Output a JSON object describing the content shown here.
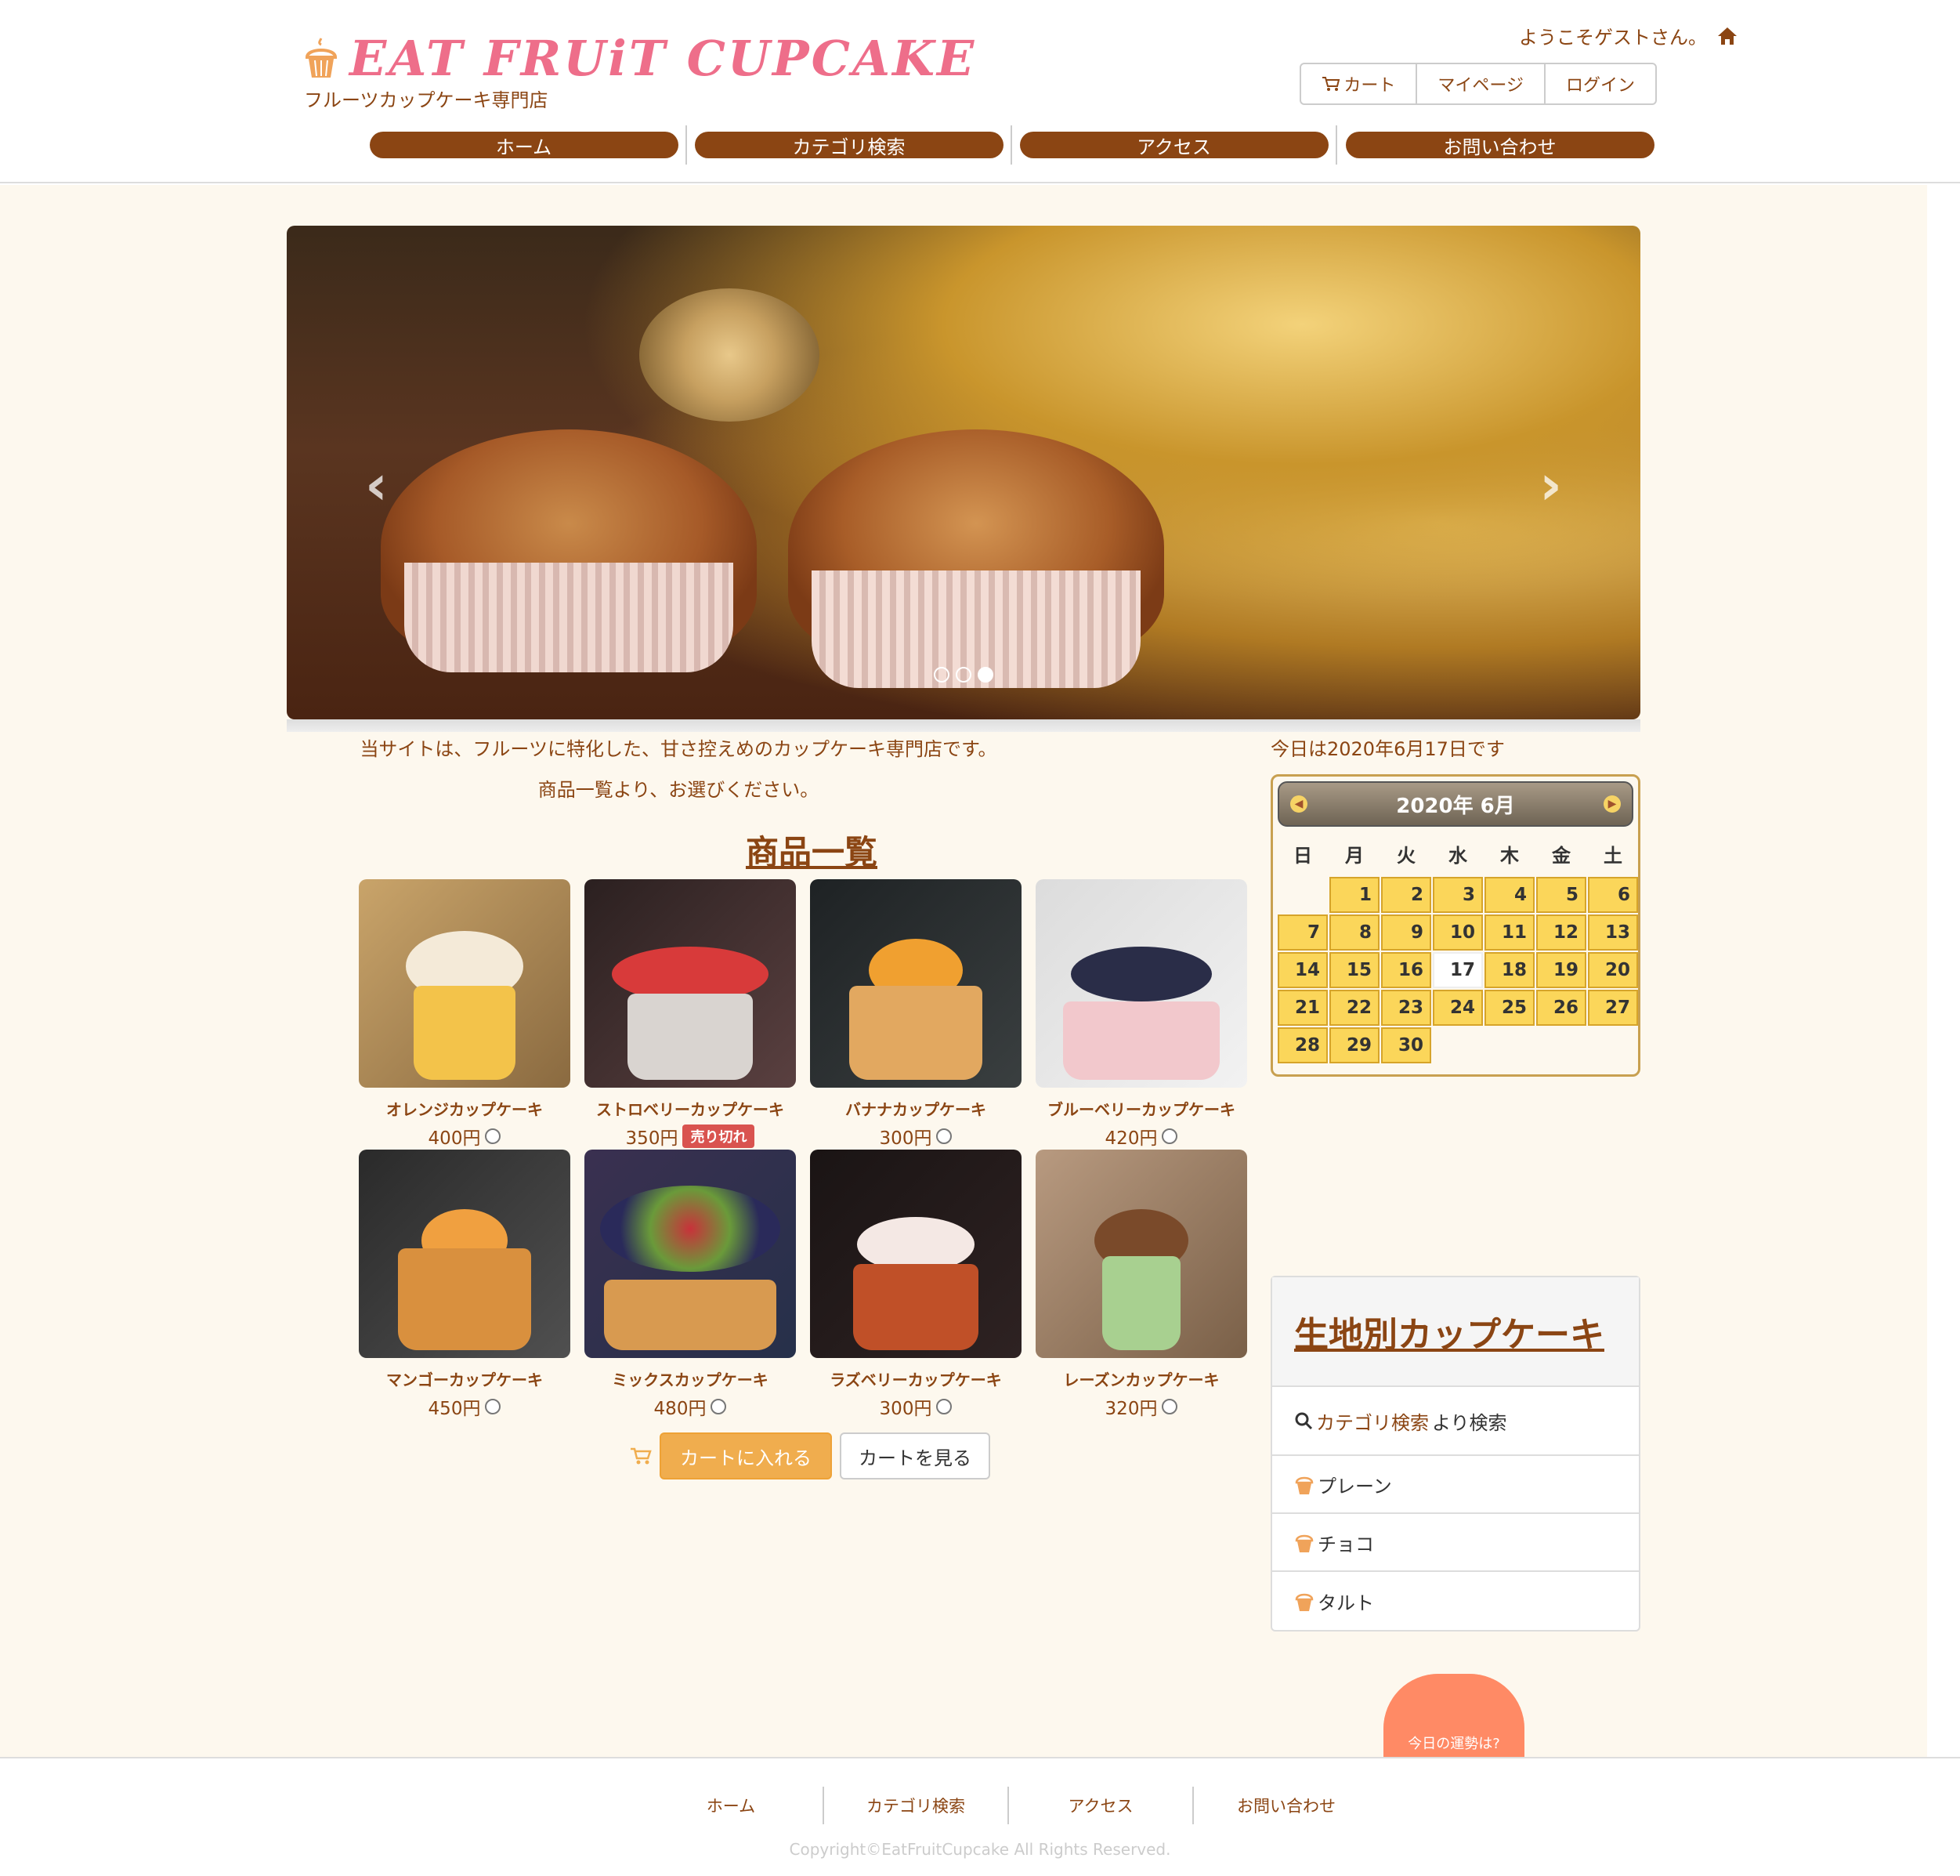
{
  "header": {
    "logo_text": "EAT FRUiT CUPCAKE",
    "tagline": "フルーツカップケーキ専門店",
    "welcome": "ようこそゲストさん。",
    "top_buttons": {
      "cart": "カート",
      "mypage": "マイページ",
      "login": "ログイン"
    },
    "nav": [
      "ホーム",
      "カテゴリ検索",
      "アクセス",
      "お問い合わせ"
    ]
  },
  "intro": {
    "line1": "当サイトは、フルーツに特化した、甘さ控えめのカップケーキ専門店です。",
    "line2": "商品一覧より、お選びください。"
  },
  "products_title": "商品一覧",
  "products": [
    {
      "name": "オレンジカップケーキ",
      "price": "400円",
      "sold_out": false
    },
    {
      "name": "ストロベリーカップケーキ",
      "price": "350円",
      "sold_out": true
    },
    {
      "name": "バナナカップケーキ",
      "price": "300円",
      "sold_out": false
    },
    {
      "name": "ブルーベリーカップケーキ",
      "price": "420円",
      "sold_out": false
    },
    {
      "name": "マンゴーカップケーキ",
      "price": "450円",
      "sold_out": false
    },
    {
      "name": "ミックスカップケーキ",
      "price": "480円",
      "sold_out": false
    },
    {
      "name": "ラズベリーカップケーキ",
      "price": "300円",
      "sold_out": false
    },
    {
      "name": "レーズンカップケーキ",
      "price": "320円",
      "sold_out": false
    }
  ],
  "sold_out_label": "売り切れ",
  "cart_actions": {
    "add": "カートに入れる",
    "view": "カートを見る"
  },
  "today_text": "今日は2020年6月17日です",
  "calendar": {
    "title": "2020年 6月",
    "weekdays": [
      "日",
      "月",
      "火",
      "水",
      "木",
      "金",
      "土"
    ],
    "days": [
      "",
      "1",
      "2",
      "3",
      "4",
      "5",
      "6",
      "7",
      "8",
      "9",
      "10",
      "11",
      "12",
      "13",
      "14",
      "15",
      "16",
      "17",
      "18",
      "19",
      "20",
      "21",
      "22",
      "23",
      "24",
      "25",
      "26",
      "27",
      "28",
      "29",
      "30"
    ],
    "today": "17"
  },
  "category_panel": {
    "title": "生地別カップケーキ",
    "search_link": "カテゴリ検索",
    "search_suffix": "より検索",
    "items": [
      "プレーン",
      "チョコ",
      "タルト"
    ]
  },
  "fortune_button": "今日の運勢は?",
  "footer": {
    "links": [
      "ホーム",
      "カテゴリ検索",
      "アクセス",
      "お問い合わせ"
    ],
    "copyright": "Copyright©EatFruitCupcake All Rights Reserved."
  },
  "colors": {
    "brand_brown": "#8b4513",
    "logo_pink": "#ee6e8a",
    "accent_orange": "#f0ad4e",
    "background_cream": "#fdf8ee",
    "soldout_red": "#d9534f",
    "fortune_coral": "#ff8a65"
  }
}
